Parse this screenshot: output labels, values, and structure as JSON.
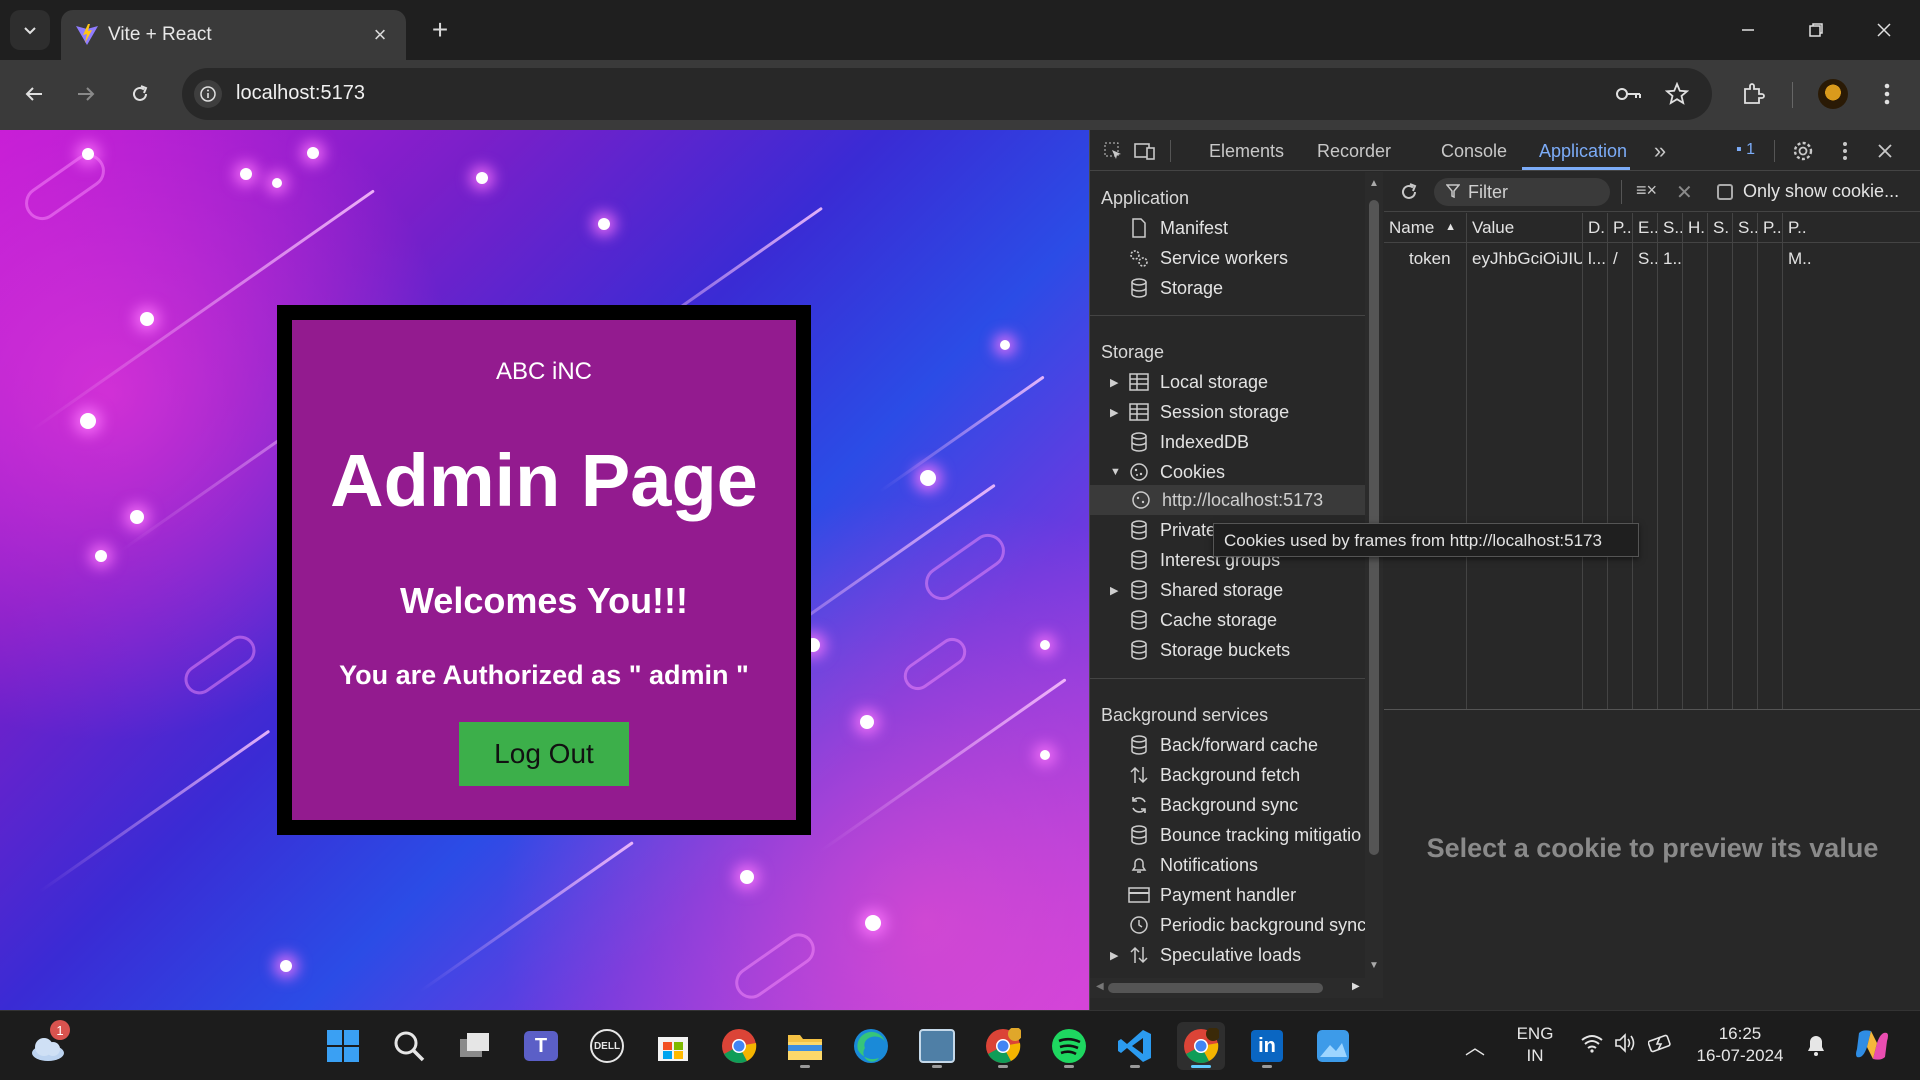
{
  "browser": {
    "tab_title": "Vite + React",
    "url": "localhost:5173"
  },
  "page": {
    "company": "ABC iNC",
    "title": "Admin Page",
    "welcome": "Welcomes You!!!",
    "auth_text": "You are Authorized as \" admin \"",
    "logout_label": "Log Out"
  },
  "devtools": {
    "tabs": [
      "Elements",
      "Recorder",
      "Console",
      "Application"
    ],
    "active_tab": "Application",
    "issues_count": "1",
    "sidebar": {
      "application_title": "Application",
      "application_items": [
        "Manifest",
        "Service workers",
        "Storage"
      ],
      "storage_title": "Storage",
      "storage_items": [
        "Local storage",
        "Session storage",
        "IndexedDB",
        "Cookies",
        "http://localhost:5173",
        "Private",
        "Interest groups",
        "Shared storage",
        "Cache storage",
        "Storage buckets"
      ],
      "background_title": "Background services",
      "background_items": [
        "Back/forward cache",
        "Background fetch",
        "Background sync",
        "Bounce tracking mitigatio",
        "Notifications",
        "Payment handler",
        "Periodic background sync",
        "Speculative loads"
      ]
    },
    "filter_placeholder": "Filter",
    "only_show_label": "Only show cookie...",
    "cookie_table": {
      "headers": [
        "Name",
        "Value",
        "D.",
        "P..",
        "E..",
        "S..",
        "H.",
        "S.",
        "S..",
        "P..",
        "P.."
      ],
      "row": [
        "token",
        "eyJhbGciOiJIU...",
        "l...",
        "/",
        "S...",
        "1...",
        "",
        "",
        "",
        "",
        "M.."
      ]
    },
    "preview_message": "Select a cookie to preview its value",
    "tooltip": "Cookies used by frames from http://localhost:5173"
  },
  "taskbar": {
    "weather_badge": "1",
    "language": "ENG",
    "region": "IN",
    "time": "16:25",
    "date": "16-07-2024"
  },
  "colors": {
    "accent_blue": "#7cacf8",
    "card_bg": "#931b8f",
    "logout_green": "#3caf4a"
  }
}
